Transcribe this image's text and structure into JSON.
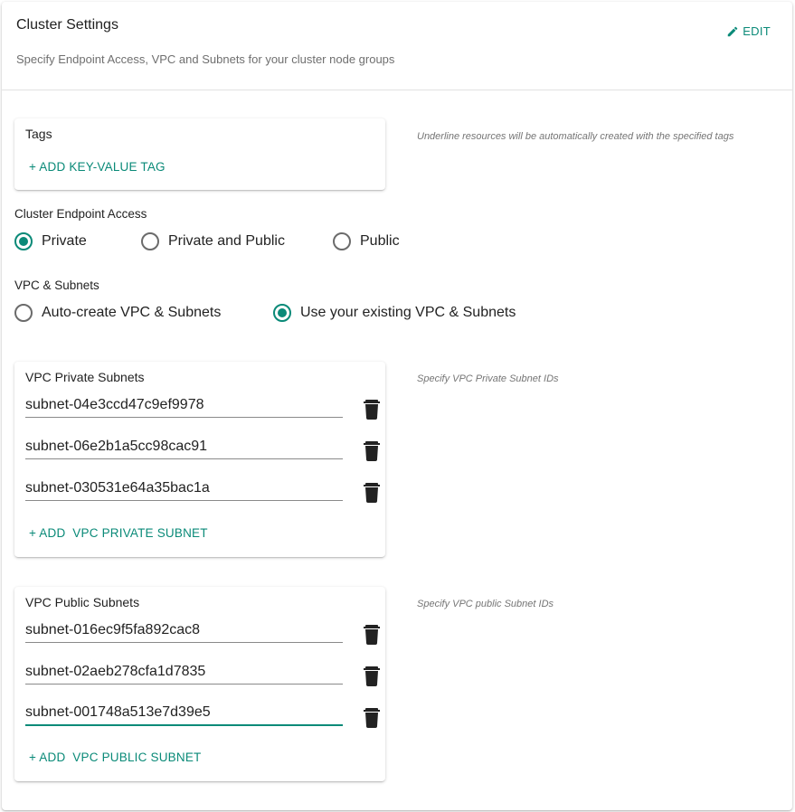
{
  "header": {
    "title": "Cluster Settings",
    "subtitle": "Specify Endpoint Access, VPC and Subnets for your cluster node groups",
    "edit_label": "EDIT"
  },
  "tags": {
    "title": "Tags",
    "add_label": "+ ADD KEY-VALUE TAG",
    "hint": "Underline resources will be automatically created with the specified tags"
  },
  "endpoint_access": {
    "label": "Cluster Endpoint Access",
    "options": [
      {
        "label": "Private",
        "checked": true
      },
      {
        "label": "Private and Public",
        "checked": false
      },
      {
        "label": "Public",
        "checked": false
      }
    ]
  },
  "vpc": {
    "label": "VPC & Subnets",
    "options": [
      {
        "label": "Auto-create VPC & Subnets",
        "checked": false
      },
      {
        "label": "Use your existing VPC & Subnets",
        "checked": true
      }
    ]
  },
  "private_subnets": {
    "title": "VPC Private Subnets",
    "hint": "Specify VPC Private Subnet IDs",
    "values": [
      "subnet-04e3ccd47c9ef9978",
      "subnet-06e2b1a5cc98cac91",
      "subnet-030531e64a35bac1a"
    ],
    "add_label": "+ ADD  VPC PRIVATE SUBNET"
  },
  "public_subnets": {
    "title": "VPC Public Subnets",
    "hint": "Specify VPC public Subnet IDs",
    "values": [
      "subnet-016ec9f5fa892cac8",
      "subnet-02aeb278cfa1d7835",
      "subnet-001748a513e7d39e5"
    ],
    "add_label": "+ ADD  VPC PUBLIC SUBNET",
    "focused_index": 2
  },
  "colors": {
    "accent": "#0a8a78",
    "icon": "#222222"
  }
}
